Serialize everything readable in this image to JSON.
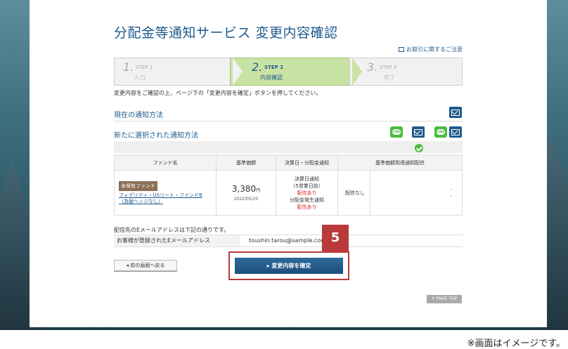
{
  "header": {
    "title": "分配金等通知サービス 変更内容確認",
    "notice_link": "お取引に関するご注意"
  },
  "steps": [
    {
      "num": "1.",
      "label": "STEP 1",
      "sub": "入力"
    },
    {
      "num": "2.",
      "label": "STEP 2",
      "sub": "内容確認"
    },
    {
      "num": "3.",
      "label": "STEP 3",
      "sub": "完了"
    }
  ],
  "instruction": "変更内容をご確認の上、ページ下の「変更内容を確定」ボタンを押してください。",
  "sections": {
    "current": "現在の通知方法",
    "new": "新たに選択された通知方法"
  },
  "icons": {
    "mail": "mail-icon",
    "line": "line-icon",
    "check": "check-icon"
  },
  "table": {
    "headers": [
      "ファンド名",
      "基準価額",
      "決算日・分配金通知",
      "基準価額到達通知配信"
    ],
    "row": {
      "badge": "未保有ファンド",
      "fund_name": "フィデリティ・USリート・ファンドB（為替ヘッジなし）",
      "price": "3,380",
      "price_unit": "円",
      "date": "2022/05/20",
      "notify_1": "決算日通知",
      "notify_2": "（5営業日前）",
      "notify_3": "配信あり",
      "notify_4": "分配金発生通知",
      "notify_5": "配信あり",
      "reach": "配信なし",
      "dash1": "-",
      "dash2": "-"
    }
  },
  "mail": {
    "note": "配信先のEメールアドレスは下記の通りです。",
    "label": "お客様が登録されたEメールアドレス",
    "value": "toushin.tarou@sample.com"
  },
  "buttons": {
    "back": "◂ 前の画面へ戻る",
    "confirm": "▸ 変更内容を確定",
    "page_top": "⇑ PAGE TOP"
  },
  "callout_number": "5",
  "caption": "※画面はイメージです。",
  "colors": {
    "accent": "#1f5a8c",
    "highlight": "#b93a3a",
    "line_green": "#4cbb3d",
    "badge": "#8b6f55"
  }
}
